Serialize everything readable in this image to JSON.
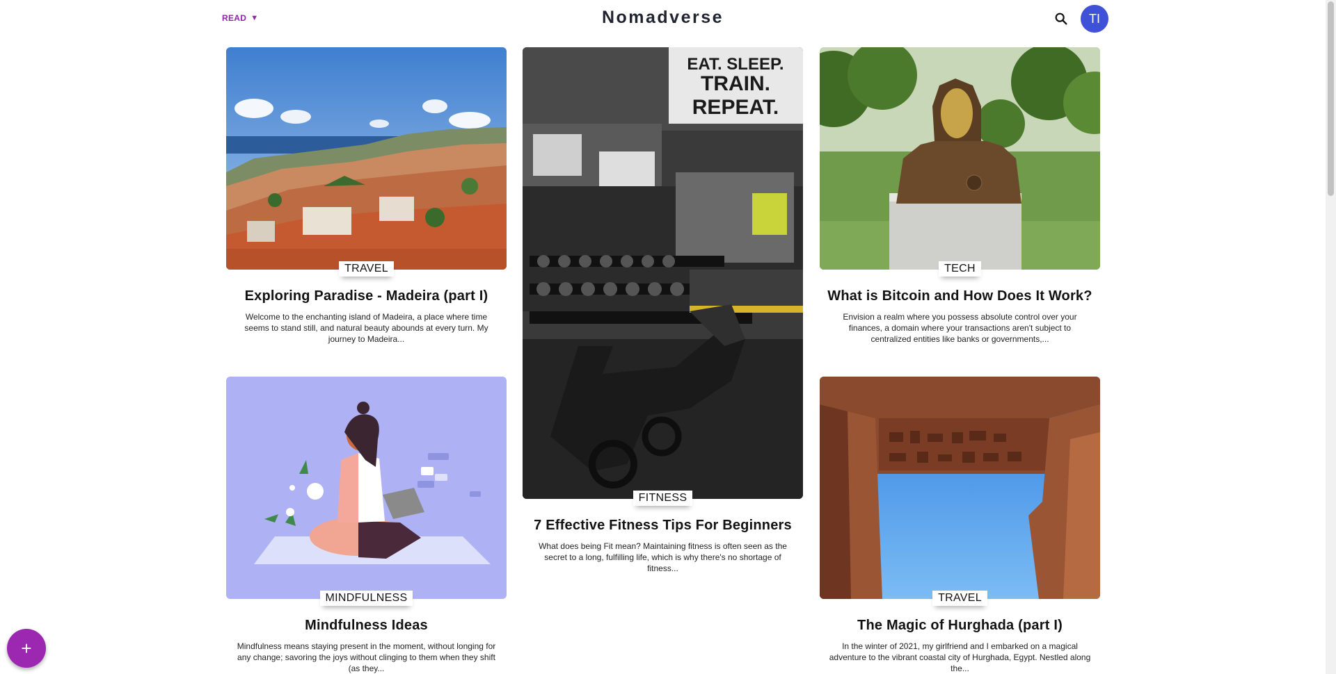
{
  "header": {
    "read_label": "READ",
    "caret": "▼",
    "brand": "Nomadverse",
    "avatar_initials": "TI",
    "search_icon": "search-icon"
  },
  "posts": [
    {
      "category": "TRAVEL",
      "title": "Exploring Paradise - Madeira (part I)",
      "excerpt": "Welcome to the enchanting island of Madeira, a place where time seems to stand still, and natural beauty abounds at every turn. My journey to Madeira..."
    },
    {
      "category": "FITNESS",
      "title": "7 Effective Fitness Tips For Beginners",
      "excerpt": "What does being Fit mean? Maintaining fitness is often seen as the secret to a long, fulfilling life, which is why there's no shortage of fitness..."
    },
    {
      "category": "TECH",
      "title": "What is Bitcoin and How Does It Work?",
      "excerpt": "Envision a realm where you possess absolute control over your finances, a domain where your transactions aren't subject to centralized entities like banks or governments,..."
    },
    {
      "category": "MINDFULNESS",
      "title": "Mindfulness Ideas",
      "excerpt": "Mindfulness means staying present in the moment, without longing for any change; savoring the joys without clinging to them when they shift (as they..."
    },
    {
      "category": "TRAVEL",
      "title": "The Magic of Hurghada (part I)",
      "excerpt": "In the winter of 2021, my girlfriend and I embarked on a magical adventure to the vibrant coastal city of Hurghada, Egypt. Nestled along the..."
    }
  ],
  "gym_sign": {
    "line1": "EAT. SLEEP.",
    "line2": "TRAIN.",
    "line3": "REPEAT."
  },
  "fab_label": "+",
  "colors": {
    "accent": "#9c27b0",
    "avatar": "#3f51d6",
    "read": "#8e24aa"
  }
}
